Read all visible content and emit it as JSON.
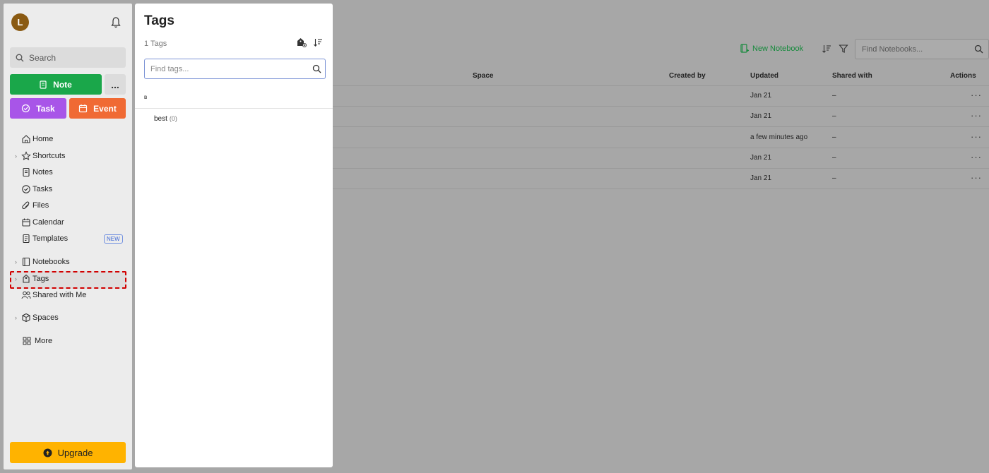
{
  "sidebar": {
    "avatar_letter": "L",
    "search_label": "Search",
    "note_label": "Note",
    "more_label": "...",
    "task_label": "Task",
    "event_label": "Event",
    "nav": {
      "home": "Home",
      "shortcuts": "Shortcuts",
      "notes": "Notes",
      "tasks": "Tasks",
      "files": "Files",
      "calendar": "Calendar",
      "templates": "Templates",
      "templates_badge": "NEW",
      "notebooks": "Notebooks",
      "tags": "Tags",
      "shared": "Shared with Me",
      "spaces": "Spaces",
      "more": "More"
    },
    "upgrade_label": "Upgrade"
  },
  "notebooks": {
    "new_notebook_label": "New Notebook",
    "find_placeholder": "Find Notebooks...",
    "columns": {
      "space": "Space",
      "created_by": "Created by",
      "updated": "Updated",
      "shared_with": "Shared with",
      "actions": "Actions"
    },
    "rows": [
      {
        "updated": "Jan 21",
        "shared": "–",
        "actions": "···"
      },
      {
        "updated": "Jan 21",
        "shared": "–",
        "actions": "···"
      },
      {
        "updated": "a few minutes ago",
        "shared": "–",
        "actions": "···"
      },
      {
        "updated": "Jan 21",
        "shared": "–",
        "actions": "···"
      },
      {
        "updated": "Jan 21",
        "shared": "–",
        "actions": "···"
      }
    ]
  },
  "tags_panel": {
    "title": "Tags",
    "count": "1 Tags",
    "find_placeholder": "Find tags...",
    "group_letter": "B",
    "items": [
      {
        "name": "best",
        "count": "(0)"
      }
    ]
  },
  "colors": {
    "note": "#1aa74a",
    "task": "#a855e8",
    "event": "#f06a34",
    "upgrade": "#ffb300",
    "highlight": "#d10000"
  }
}
